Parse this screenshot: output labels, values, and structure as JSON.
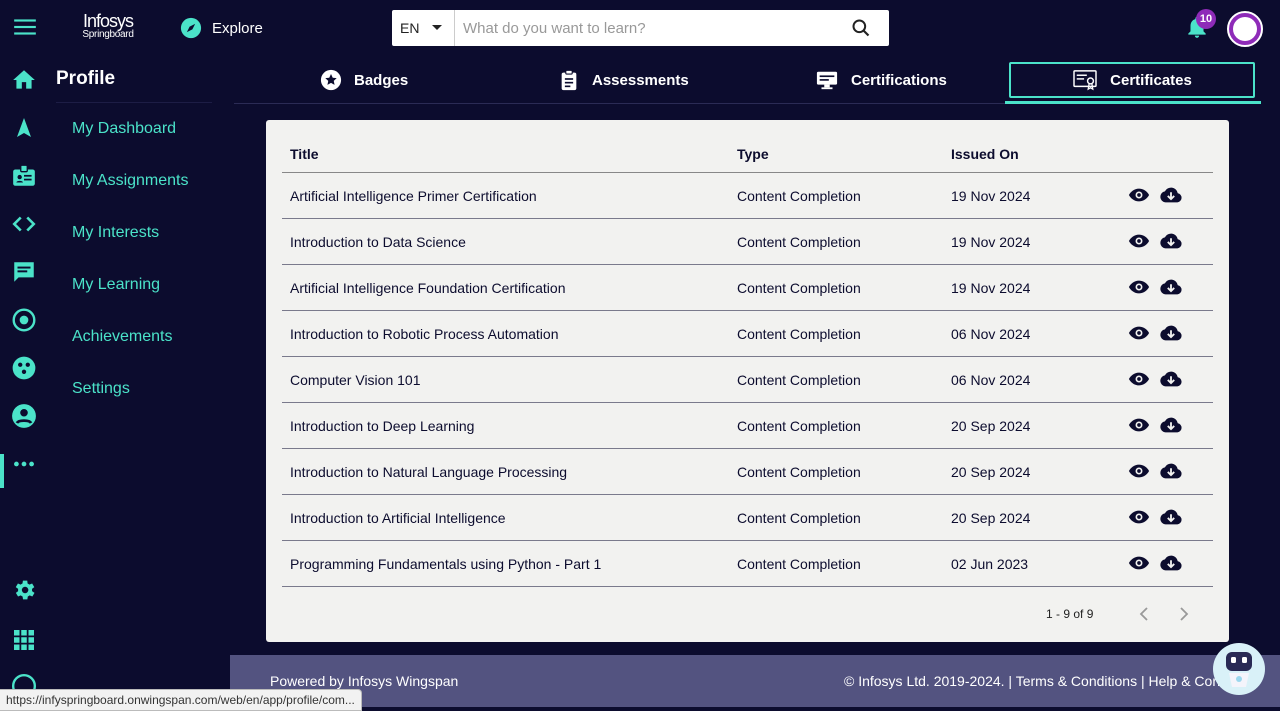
{
  "header": {
    "logo_line1": "Infosys",
    "logo_line2": "Springboard",
    "explore_label": "Explore",
    "language": "EN",
    "search_placeholder": "What do you want to learn?",
    "notification_count": "10"
  },
  "sidebar": {
    "title": "Profile",
    "items": [
      {
        "label": "My Dashboard"
      },
      {
        "label": "My Assignments"
      },
      {
        "label": "My Interests"
      },
      {
        "label": "My Learning"
      },
      {
        "label": "Achievements"
      },
      {
        "label": "Settings"
      }
    ]
  },
  "rail": {
    "icons": [
      "home-icon",
      "navigation-icon",
      "badge-id-icon",
      "code-icon",
      "chat-icon",
      "target-icon",
      "community-icon",
      "profile-icon",
      "more-icon",
      "settings-icon",
      "apps-grid-icon",
      "help-icon"
    ],
    "active": "profile-icon"
  },
  "tabs": [
    {
      "label": "Badges",
      "icon": "star-icon"
    },
    {
      "label": "Assessments",
      "icon": "clipboard-icon"
    },
    {
      "label": "Certifications",
      "icon": "monitor-icon"
    },
    {
      "label": "Certificates",
      "icon": "certificate-icon",
      "active": true
    }
  ],
  "table": {
    "columns": [
      "Title",
      "Type",
      "Issued On"
    ],
    "rows": [
      {
        "title": "Artificial Intelligence Primer Certification",
        "type": "Content Completion",
        "issued": "19 Nov 2024"
      },
      {
        "title": "Introduction to Data Science",
        "type": "Content Completion",
        "issued": "19 Nov 2024"
      },
      {
        "title": "Artificial Intelligence Foundation Certification",
        "type": "Content Completion",
        "issued": "19 Nov 2024"
      },
      {
        "title": "Introduction to Robotic Process Automation",
        "type": "Content Completion",
        "issued": "06 Nov 2024"
      },
      {
        "title": "Computer Vision 101",
        "type": "Content Completion",
        "issued": "06 Nov 2024"
      },
      {
        "title": "Introduction to Deep Learning",
        "type": "Content Completion",
        "issued": "20 Sep 2024"
      },
      {
        "title": "Introduction to Natural Language Processing",
        "type": "Content Completion",
        "issued": "20 Sep 2024"
      },
      {
        "title": "Introduction to Artificial Intelligence",
        "type": "Content Completion",
        "issued": "20 Sep 2024"
      },
      {
        "title": "Programming Fundamentals using Python - Part 1",
        "type": "Content Completion",
        "issued": "02 Jun 2023"
      }
    ],
    "pagination": "1 - 9 of 9"
  },
  "footer": {
    "powered_by": "Powered by Infosys Wingspan",
    "copyright": "© Infosys Ltd. 2019-2024. | ",
    "terms": "Terms & Conditions",
    "separator": " | ",
    "help": "Help & Con"
  },
  "status_url": "https://infyspringboard.onwingspan.com/web/en/app/profile/com...",
  "colors": {
    "background": "#0c0c2e",
    "accent": "#4be3c9",
    "card": "#f2f2f0",
    "footer": "#535380",
    "badge": "#8e2bb8"
  }
}
